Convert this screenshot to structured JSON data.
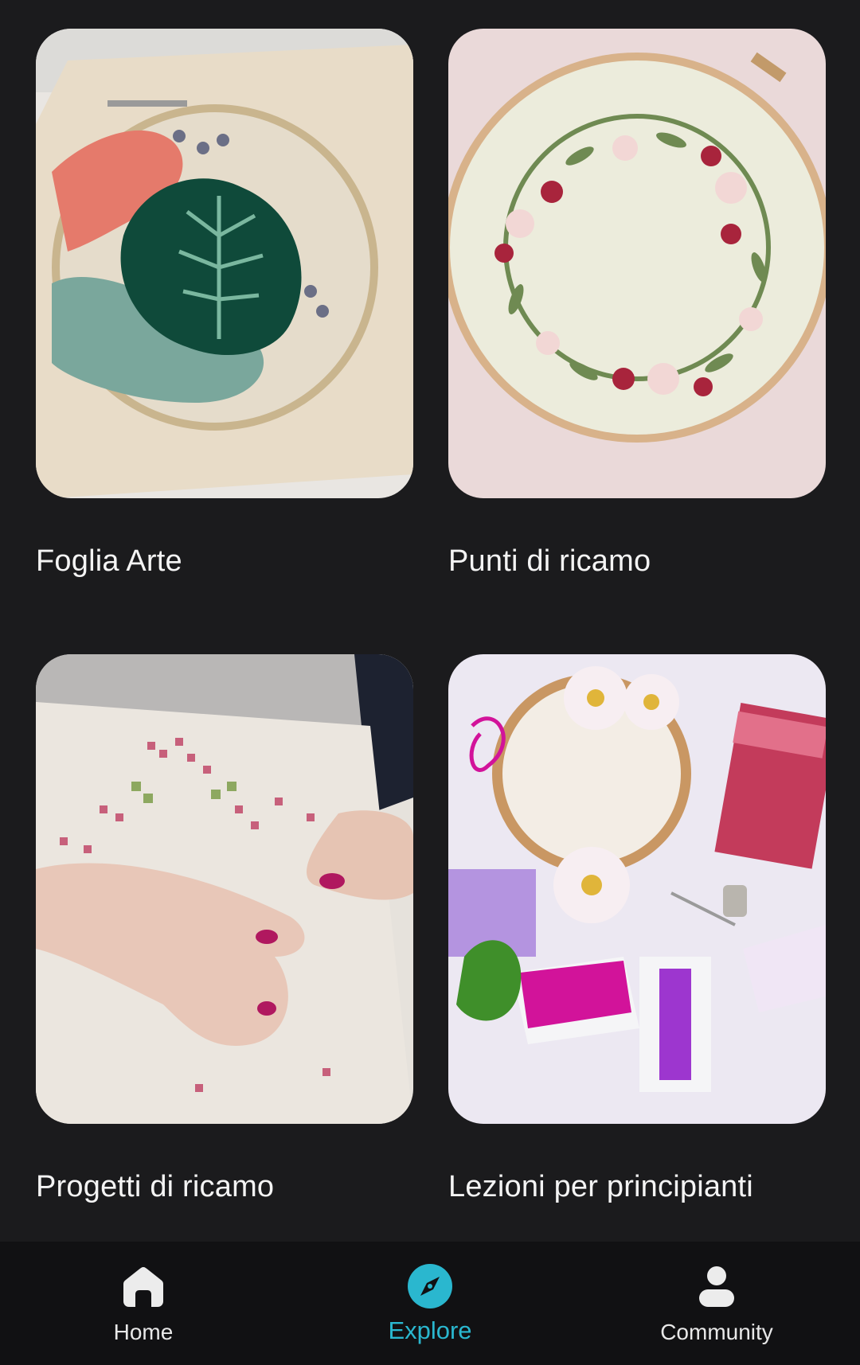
{
  "cards": [
    {
      "title": "Foglia Arte"
    },
    {
      "title": "Punti di ricamo"
    },
    {
      "title": "Progetti di ricamo"
    },
    {
      "title": "Lezioni per principianti"
    }
  ],
  "nav": {
    "items": [
      {
        "label": "Home",
        "icon": "home-icon",
        "active": false
      },
      {
        "label": "Explore",
        "icon": "compass-icon",
        "active": true
      },
      {
        "label": "Community",
        "icon": "person-icon",
        "active": false
      }
    ],
    "active_color": "#2ab7cf",
    "inactive_color": "#e8e8e8"
  }
}
